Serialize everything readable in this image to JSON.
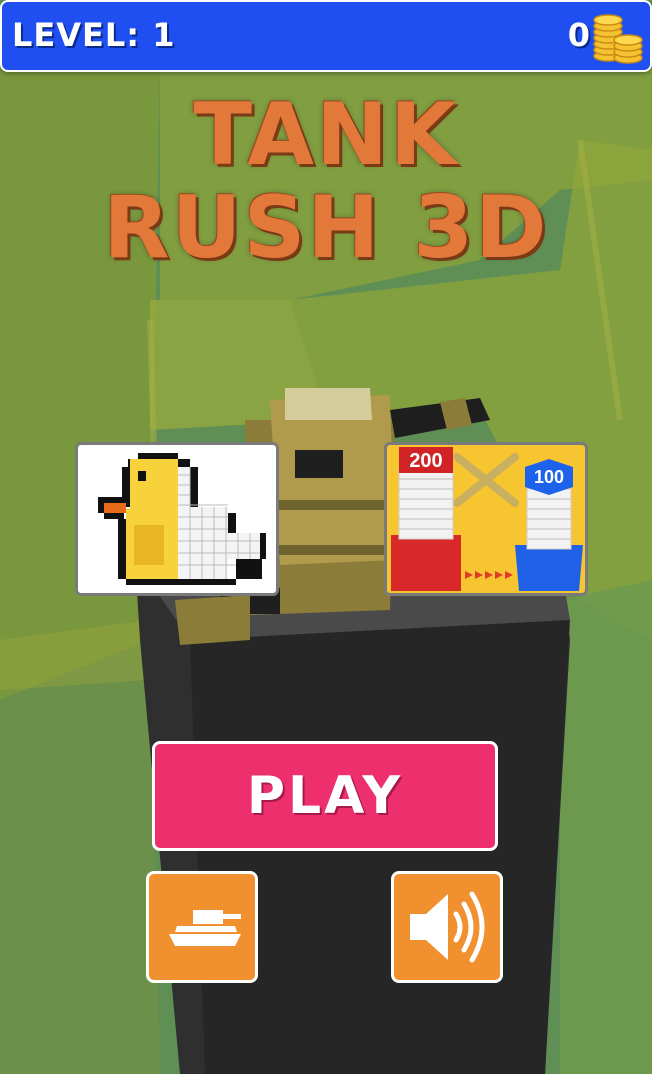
{
  "header": {
    "level_text": "LEVEL: 1",
    "coins": "0",
    "coins_icon": "coin-stack-icon"
  },
  "title": {
    "line1": "TANK",
    "line2": "RUSH 3D"
  },
  "promos": {
    "left": {
      "icon": "pixel-duck-icon"
    },
    "right": {
      "icon": "stack-battle-icon",
      "red_value": "200",
      "blue_value": "100"
    }
  },
  "buttons": {
    "play_label": "PLAY",
    "tank_icon": "tank-icon",
    "sound_icon": "speaker-icon"
  },
  "colors": {
    "topbar": "#1f4ff0",
    "play": "#ee2f6e",
    "square_buttons": "#f0902e",
    "title": "#e2783a"
  }
}
